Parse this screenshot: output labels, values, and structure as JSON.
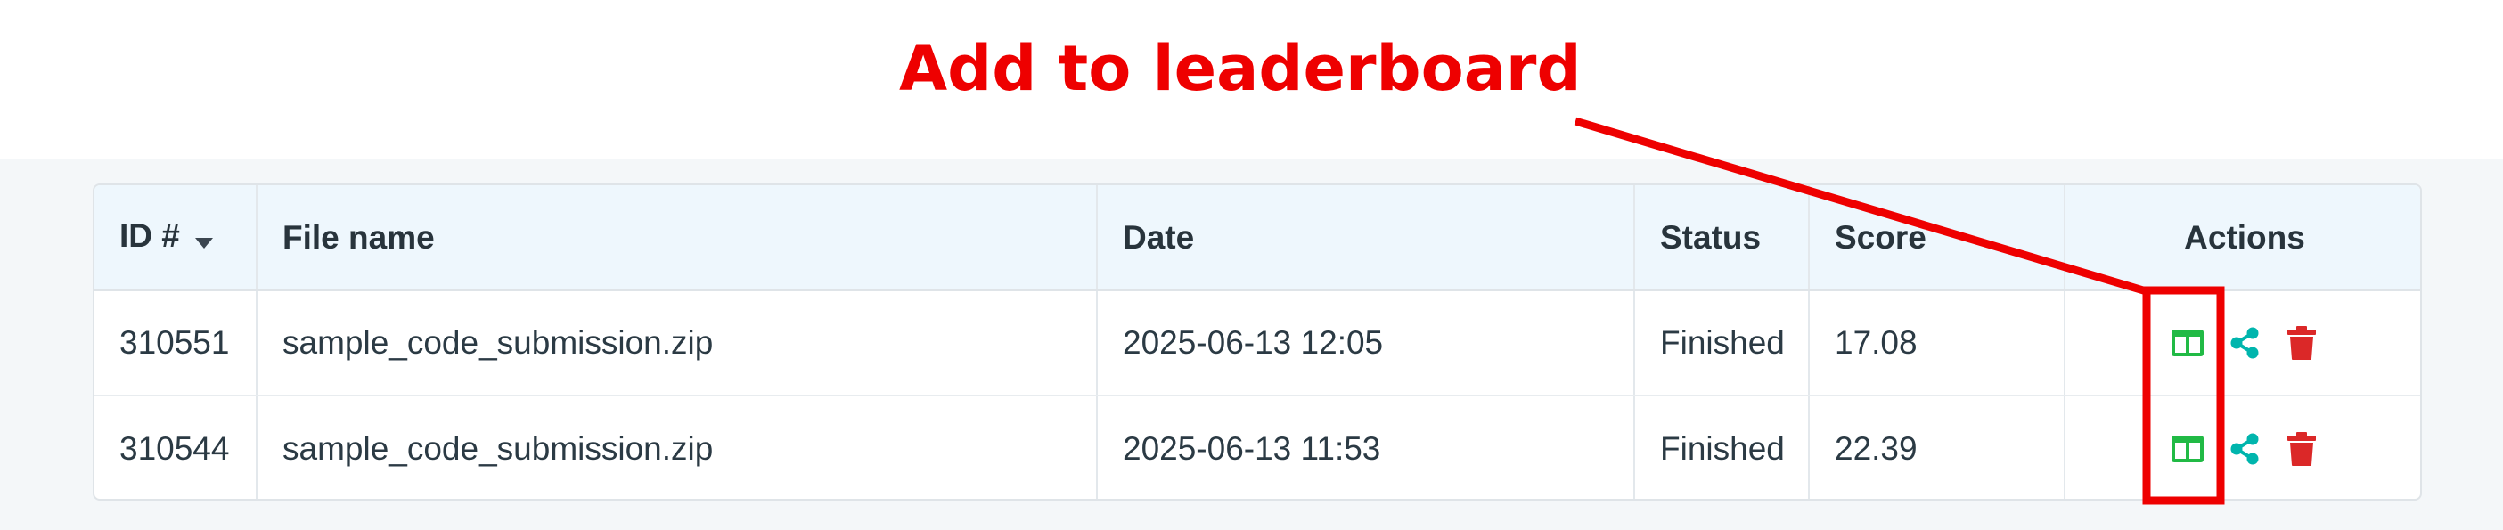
{
  "annotation": {
    "title": "Add to leaderboard",
    "color": "#ee0000"
  },
  "table": {
    "columns": {
      "id": "ID #",
      "file_name": "File name",
      "date": "Date",
      "status": "Status",
      "score": "Score",
      "actions": "Actions"
    },
    "sort_icon": "caret-down-icon",
    "rows": [
      {
        "id": "310551",
        "file_name": "sample_code_submission.zip",
        "date": "2025-06-13 12:05",
        "status": "Finished",
        "score": "17.08"
      },
      {
        "id": "310544",
        "file_name": "sample_code_submission.zip",
        "date": "2025-06-13 11:53",
        "status": "Finished",
        "score": "22.39"
      }
    ],
    "action_icons": [
      "leaderboard-columns-icon",
      "share-icon",
      "trash-icon"
    ]
  },
  "colors": {
    "leaderboard_icon": "#21ba45",
    "share_icon": "#00b5ad",
    "delete_icon": "#db2828",
    "header_bg": "#eef7fd",
    "panel_bg": "#f4f7f9"
  }
}
